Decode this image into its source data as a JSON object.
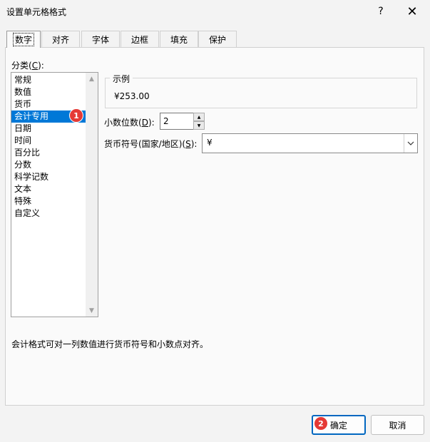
{
  "window": {
    "title": "设置单元格格式",
    "help_glyph": "?",
    "close_glyph": "✕"
  },
  "tabs": [
    {
      "label": "数字",
      "active": true
    },
    {
      "label": "对齐",
      "active": false
    },
    {
      "label": "字体",
      "active": false
    },
    {
      "label": "边框",
      "active": false
    },
    {
      "label": "填充",
      "active": false
    },
    {
      "label": "保护",
      "active": false
    }
  ],
  "category": {
    "label_prefix": "分类(",
    "label_key": "C",
    "label_suffix": "):",
    "items": [
      "常规",
      "数值",
      "货币",
      "会计专用",
      "日期",
      "时间",
      "百分比",
      "分数",
      "科学记数",
      "文本",
      "特殊",
      "自定义"
    ],
    "selected": "会计专用"
  },
  "sample": {
    "legend": "示例",
    "value": "¥253.00"
  },
  "decimal_places": {
    "label_prefix": "小数位数(",
    "label_key": "D",
    "label_suffix": "):",
    "value": "2"
  },
  "currency_symbol": {
    "label_prefix": "货币符号(国家/地区)(",
    "label_key": "S",
    "label_suffix": "):",
    "value": "¥"
  },
  "description": "会计格式可对一列数值进行货币符号和小数点对齐。",
  "annotations": {
    "badge1": "1",
    "badge2": "2"
  },
  "buttons": {
    "ok": "确定",
    "cancel": "取消"
  },
  "colors": {
    "accent": "#0078d7",
    "badge": "#e53935",
    "ok_border": "#0067c0"
  }
}
